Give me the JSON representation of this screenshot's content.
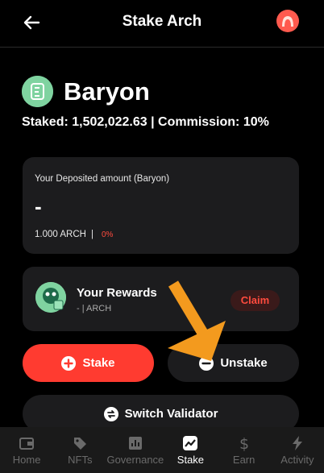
{
  "header": {
    "title": "Stake Arch"
  },
  "validator": {
    "name": "Baryon",
    "staked_line": "Staked: 1,502,022.63 | Commission: 10%"
  },
  "deposit": {
    "label": "Your Deposited amount (Baryon)",
    "value": "-",
    "amount": "1.000 ARCH",
    "separator": "|",
    "percent": "0%"
  },
  "rewards": {
    "title": "Your Rewards",
    "value": "- | ARCH",
    "claim_label": "Claim"
  },
  "actions": {
    "stake_label": "Stake",
    "unstake_label": "Unstake",
    "switch_label": "Switch Validator"
  },
  "tabs": [
    {
      "label": "Home",
      "icon": "wallet-icon"
    },
    {
      "label": "NFTs",
      "icon": "tag-icon"
    },
    {
      "label": "Governance",
      "icon": "chart-icon"
    },
    {
      "label": "Stake",
      "icon": "stake-icon",
      "active": true
    },
    {
      "label": "Earn",
      "icon": "dollar-icon"
    },
    {
      "label": "Activity",
      "icon": "bolt-icon"
    }
  ],
  "colors": {
    "accent": "#ff3b30",
    "card": "#1c1c1e",
    "arrow": "#f39a1e",
    "logo": "#7fd3a0"
  }
}
